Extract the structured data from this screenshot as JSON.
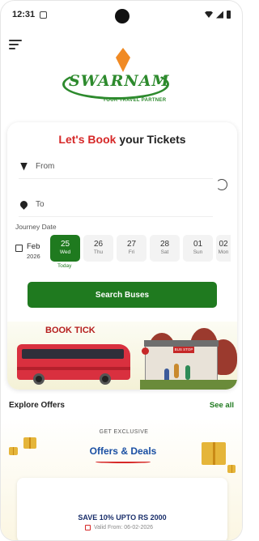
{
  "status_bar": {
    "time": "12:31"
  },
  "logo": {
    "name": "SWARNAM",
    "tagline": "YOUR TRAVEL PARTNER"
  },
  "booking": {
    "title_part1": "Let's Book",
    "title_part2": "your Tickets",
    "from_placeholder": "From",
    "to_placeholder": "To",
    "journey_date_label": "Journey Date",
    "month": "Feb",
    "year": "2026",
    "dates": [
      {
        "day": "25",
        "weekday": "Wed",
        "selected": true
      },
      {
        "day": "26",
        "weekday": "Thu",
        "selected": false
      },
      {
        "day": "27",
        "weekday": "Fri",
        "selected": false
      },
      {
        "day": "28",
        "weekday": "Sat",
        "selected": false
      },
      {
        "day": "01",
        "weekday": "Sun",
        "selected": false
      },
      {
        "day": "02",
        "weekday": "Mon",
        "selected": false
      }
    ],
    "today_label": "Today",
    "search_button": "Search Buses",
    "banner_text": "BOOK TICK",
    "bus_stop_sign": "BUS STOP"
  },
  "offers": {
    "title": "Explore Offers",
    "see_all": "See all",
    "get_exclusive": "GET EXCLUSIVE",
    "offers_deals": "Offers & Deals",
    "offer_text": "SAVE 10% UPTO RS 2000",
    "valid_from": "Valid From: 06-02-2026"
  },
  "colors": {
    "primary_green": "#1f7a1f",
    "accent_red": "#d62828",
    "deal_blue": "#1a4fa3"
  }
}
